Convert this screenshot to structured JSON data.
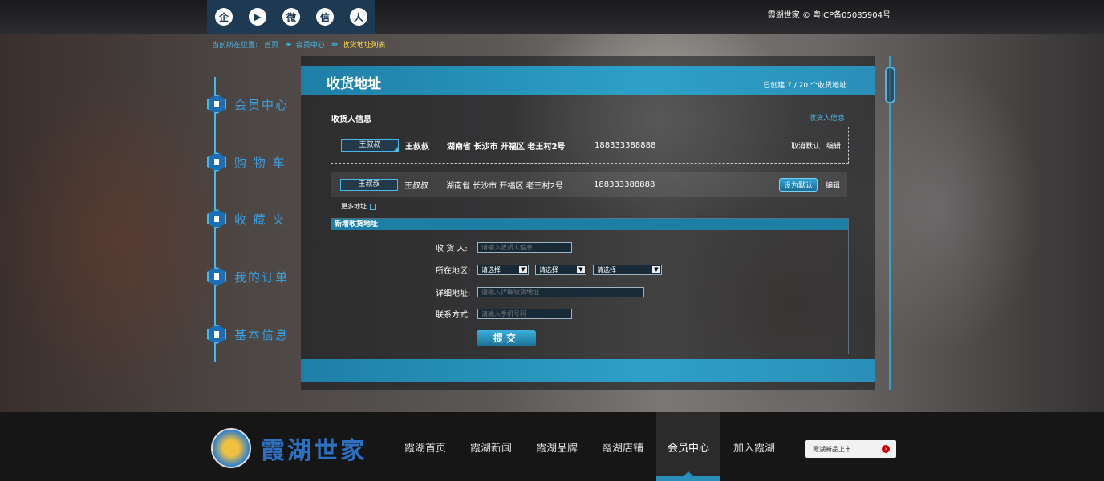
{
  "topbar": {
    "right_text": "霞湖世家 © 粤ICP备05085904号"
  },
  "social": [
    {
      "name": "tencent-icon",
      "glyph": "企"
    },
    {
      "name": "video-icon",
      "glyph": "▶"
    },
    {
      "name": "weibo-icon",
      "glyph": "微"
    },
    {
      "name": "wechat-icon",
      "glyph": "信"
    },
    {
      "name": "user-icon",
      "glyph": "人"
    }
  ],
  "breadcrumb": {
    "prefix": "当前所在位置:",
    "items": [
      "首页",
      "会员中心"
    ],
    "current": "收货地址列表",
    "sep": "»»"
  },
  "leftnav": [
    "会员中心",
    "购 物 车",
    "收 藏 夹",
    "我的订单",
    "基本信息"
  ],
  "panel": {
    "title": "收货地址",
    "count_pre": "已创建",
    "count_cur": "7",
    "count_mid": "/",
    "count_max": "20",
    "count_post": "个收货地址"
  },
  "receiver": {
    "label": "收货人信息",
    "link": "收货人信息"
  },
  "addresses": [
    {
      "tag": "王叔叔",
      "name": "王叔叔",
      "loc": "湖南省 长沙市 开福区 老王村2号",
      "phone": "188333388888",
      "action": "取消默认",
      "edit": "编辑"
    },
    {
      "tag": "王叔叔",
      "name": "王叔叔",
      "loc": "湖南省 长沙市 开福区 老王村2号",
      "phone": "188333388888",
      "action": "设为默认",
      "edit": "编辑"
    }
  ],
  "more": "更多地址",
  "newform": {
    "head": "新增收货地址",
    "receiver_label": "收 货 人:",
    "receiver_ph": "请输入收货人信息",
    "region_label": "所在地区:",
    "region_opts": [
      "请选择",
      "请选择",
      "请选择"
    ],
    "detail_label": "详细地址:",
    "detail_ph": "请输入详细收货地址",
    "contact_label": "联系方式:",
    "contact_ph": "请输入手机号码",
    "submit": "提交"
  },
  "footer": {
    "logo_text": "霞湖世家",
    "nav": [
      "霞湖首页",
      "霞湖新闻",
      "霞湖品牌",
      "霞湖店铺",
      "会员中心",
      "加入霞湖"
    ],
    "active": "会员中心",
    "search_text": "霞湖新品上市"
  }
}
